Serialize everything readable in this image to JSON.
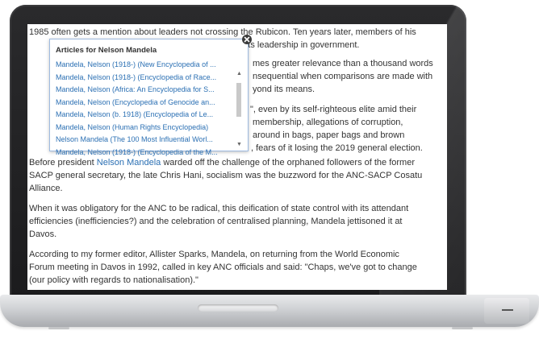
{
  "article": {
    "p0": {
      "a": "1985 often gets a mention about leaders not crossing the Rubicon. Ten years later, members of his",
      "b": "er its leadership in government."
    },
    "p1": {
      "a": "mes greater relevance than a thousand words",
      "b": "nsequential when comparisons are made with",
      "c": "yond its means."
    },
    "p2": {
      "a": "\", even by its self-righteous elite amid their",
      "b": "membership, allegations of corruption,",
      "c": "around in bags, paper bags and brown",
      "d": ", fears of it losing the 2019 general election."
    },
    "p3": {
      "pre": "Before president ",
      "link": "Nelson Mandela",
      "post": " warded off the challenge of the orphaned followers of the former",
      "b": "SACP general secretary, the late Chris Hani, socialism was the buzzword for the ANC-SACP Cosatu",
      "c": "Alliance."
    },
    "p4": {
      "a": "When it was obligatory for the ANC to be radical, this deification of state control with its attendant",
      "b": "efficiencies (inefficiencies?) and the celebration of centralised planning, Mandela jettisoned it at",
      "c": "Davos."
    },
    "p5": {
      "a": "According to my former editor, Allister Sparks, Mandela, on returning from the World Economic",
      "b": "Forum meeting in Davos in 1992, called in key ANC officials and said: \"Chaps, we've got to change",
      "c": "(our policy with regards to nationalisation).\""
    }
  },
  "popup": {
    "title": "Articles for Nelson Mandela",
    "close_icon": "close-icon",
    "items": [
      "Mandela, Nelson (1918-) (New Encyclopedia of ...",
      "Mandela, Nelson (1918-) (Encyclopedia of Race...",
      "Mandela, Nelson (Africa: An Encyclopedia for S...",
      "Mandela, Nelson (Encyclopedia of Genocide an...",
      "Mandela, Nelson (b. 1918) (Encyclopedia of Le...",
      "Mandela, Nelson (Human Rights Encyclopedia)",
      "Nelson Mandela (The 100 Most Influential Worl...",
      "Mandela, Nelson (1918-) (Encyclopedia of the M..."
    ],
    "scroll_up_icon": "▲",
    "scroll_down_icon": "▼"
  }
}
